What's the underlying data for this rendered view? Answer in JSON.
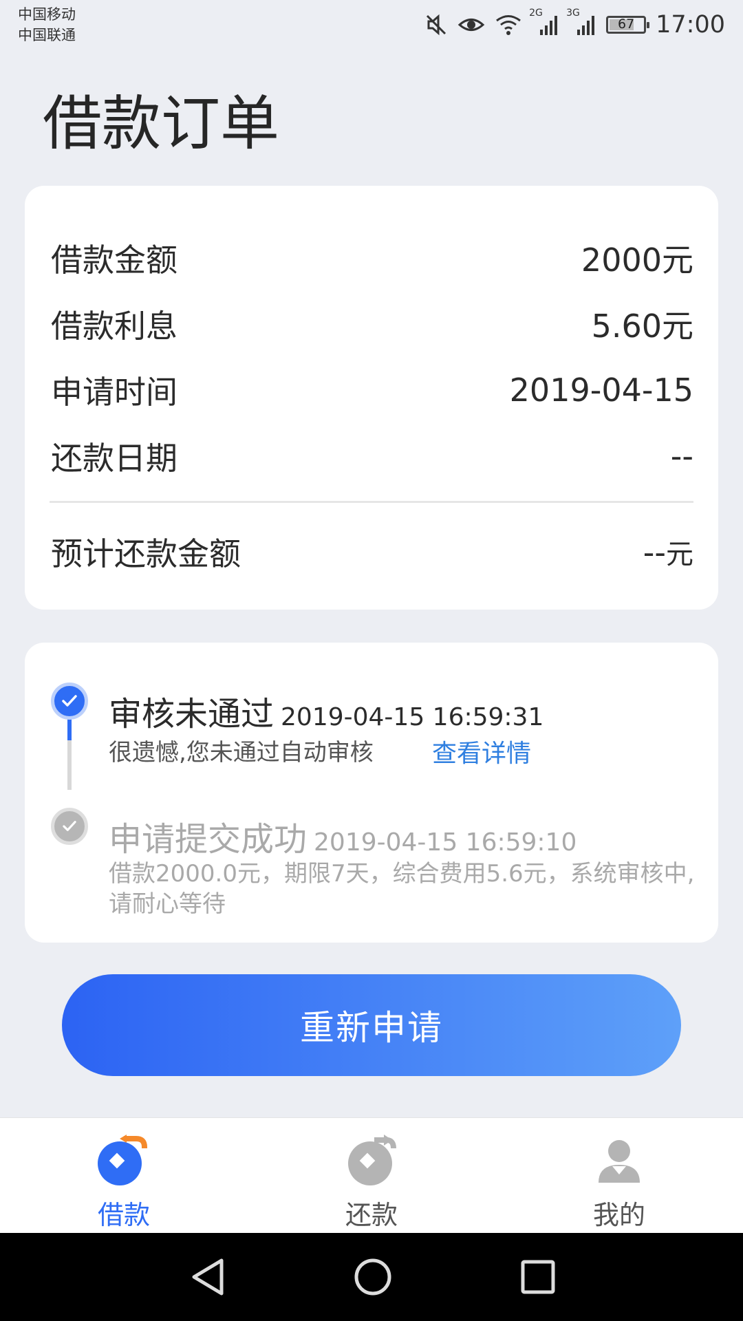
{
  "status_bar": {
    "carrier_1": "中国移动",
    "carrier_2": "中国联通",
    "network_1": "2G",
    "network_2": "3G",
    "battery": "67",
    "time": "17:00"
  },
  "page": {
    "title": "借款订单"
  },
  "loan_info": {
    "amount_label": "借款金额",
    "amount_value": "2000元",
    "interest_label": "借款利息",
    "interest_value": "5.60元",
    "apply_time_label": "申请时间",
    "apply_time_value": "2019-04-15",
    "repay_date_label": "还款日期",
    "repay_date_value": "--",
    "expected_repay_label": "预计还款金额",
    "expected_repay_value": "--",
    "expected_repay_unit": "元"
  },
  "timeline": [
    {
      "title": "审核未通过",
      "time": "2019-04-15 16:59:31",
      "desc": "很遗憾,您未通过自动审核",
      "link": "查看详情"
    },
    {
      "title": "申请提交成功",
      "time": "2019-04-15 16:59:10",
      "desc": "借款2000.0元，期限7天，综合费用5.6元，系统审核中,请耐心等待"
    }
  ],
  "reapply_label": "重新申请",
  "tabs": [
    {
      "label": "借款",
      "icon": "borrow-icon",
      "active": true
    },
    {
      "label": "还款",
      "icon": "repay-icon",
      "active": false
    },
    {
      "label": "我的",
      "icon": "profile-icon",
      "active": false
    }
  ],
  "colors": {
    "accent": "#2f6df5",
    "link": "#2f7fe0",
    "background": "#eceef3",
    "muted": "#a9a9a9"
  }
}
